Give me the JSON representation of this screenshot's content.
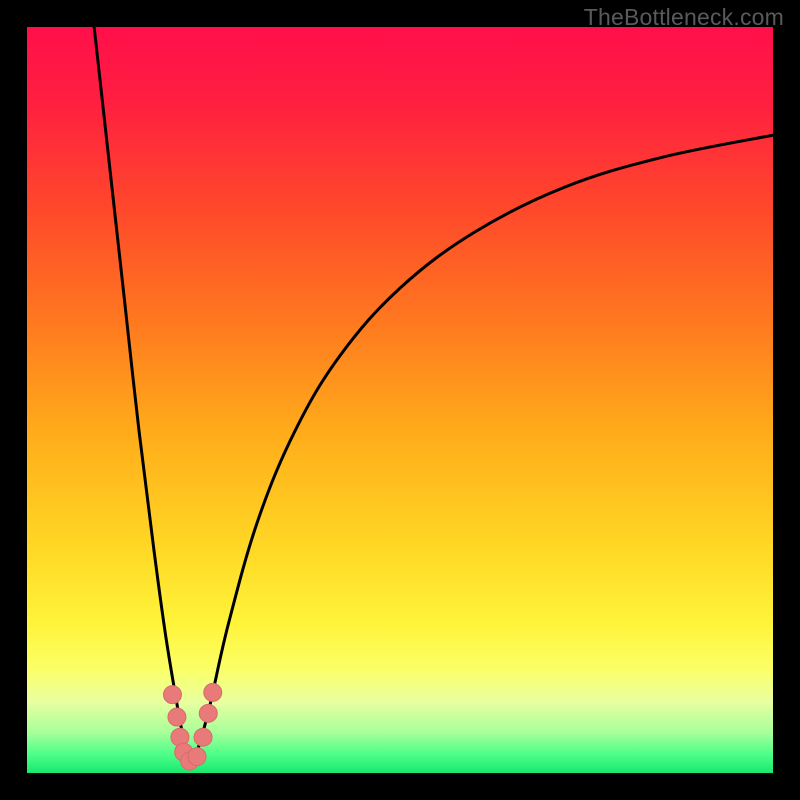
{
  "watermark": "TheBottleneck.com",
  "colors": {
    "frame": "#000000",
    "gradient_stops": [
      {
        "offset": 0.0,
        "color": "#ff0f4a"
      },
      {
        "offset": 0.1,
        "color": "#ff1f40"
      },
      {
        "offset": 0.25,
        "color": "#ff4a2a"
      },
      {
        "offset": 0.4,
        "color": "#ff7a1f"
      },
      {
        "offset": 0.55,
        "color": "#ffae1a"
      },
      {
        "offset": 0.7,
        "color": "#ffd825"
      },
      {
        "offset": 0.8,
        "color": "#fff43a"
      },
      {
        "offset": 0.86,
        "color": "#fbff66"
      },
      {
        "offset": 0.905,
        "color": "#e8ffa0"
      },
      {
        "offset": 0.945,
        "color": "#a8ff9a"
      },
      {
        "offset": 0.975,
        "color": "#4dff88"
      },
      {
        "offset": 1.0,
        "color": "#19e86f"
      }
    ],
    "curve": "#000000",
    "markers_fill": "#e97a7a",
    "markers_stroke": "#d86a6a"
  },
  "chart_data": {
    "type": "line",
    "title": "",
    "xlabel": "",
    "ylabel": "",
    "xlim": [
      0,
      100
    ],
    "ylim": [
      0,
      100
    ],
    "grid": false,
    "legend": false,
    "notes": "Axes are not labeled in the source image; x/y are normalized 0–100 estimates. y=0 at bottom (green), y=100 at top (red). Curve plunges to a sharp minimum near x≈22 then rises asymptotically.",
    "series": [
      {
        "name": "curve-left",
        "x": [
          9.0,
          11.0,
          13.0,
          15.0,
          17.0,
          18.5,
          19.8,
          20.6,
          21.3,
          22.0
        ],
        "y": [
          100.0,
          82.0,
          64.0,
          46.0,
          30.0,
          19.0,
          11.0,
          6.5,
          3.0,
          1.0
        ]
      },
      {
        "name": "curve-right",
        "x": [
          22.0,
          23.0,
          24.5,
          27.0,
          31.0,
          36.0,
          42.0,
          50.0,
          60.0,
          72.0,
          85.0,
          100.0
        ],
        "y": [
          1.0,
          3.5,
          9.0,
          20.0,
          34.0,
          46.0,
          56.0,
          65.0,
          72.5,
          78.5,
          82.5,
          85.5
        ]
      }
    ],
    "markers": {
      "name": "highlight-dots",
      "points": [
        {
          "x": 19.5,
          "y": 10.5
        },
        {
          "x": 20.1,
          "y": 7.5
        },
        {
          "x": 20.5,
          "y": 4.8
        },
        {
          "x": 21.0,
          "y": 2.8
        },
        {
          "x": 21.8,
          "y": 1.6
        },
        {
          "x": 22.8,
          "y": 2.2
        },
        {
          "x": 23.6,
          "y": 4.8
        },
        {
          "x": 24.3,
          "y": 8.0
        },
        {
          "x": 24.9,
          "y": 10.8
        }
      ],
      "radius_px": 9
    }
  }
}
